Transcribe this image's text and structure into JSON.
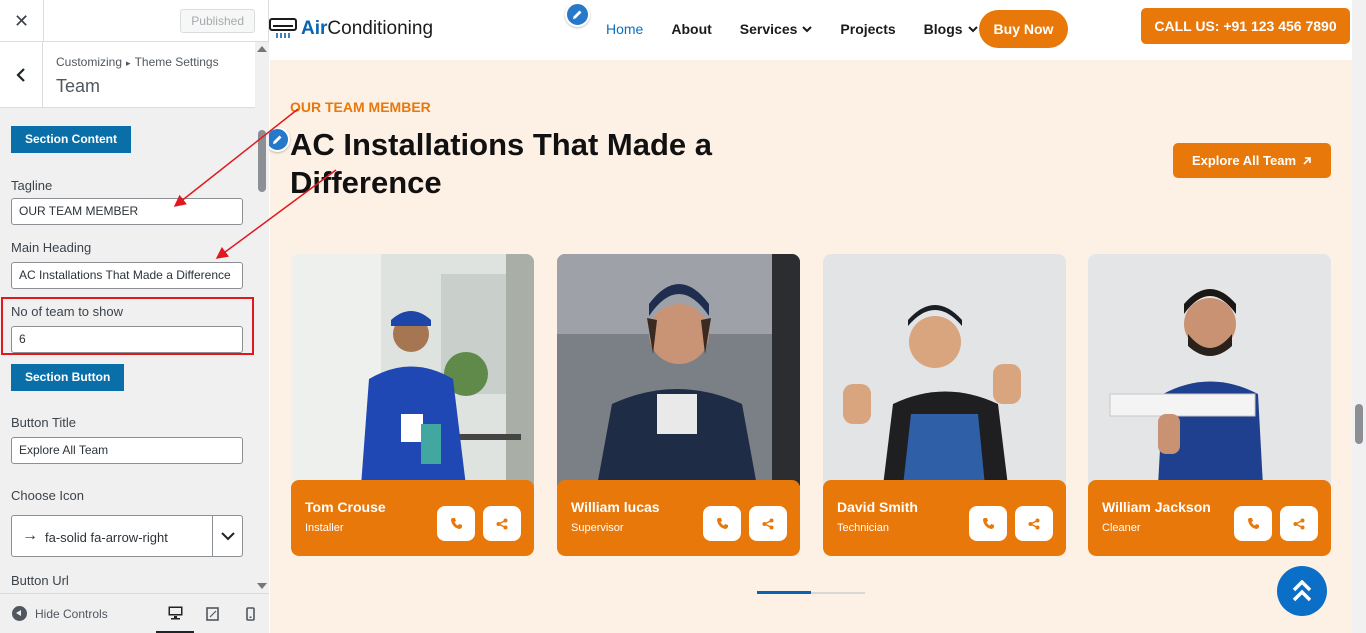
{
  "customizer": {
    "published_label": "Published",
    "breadcrumb": [
      "Customizing",
      "Theme Settings"
    ],
    "panel_title": "Team",
    "section_content_label": "Section Content",
    "tagline_label": "Tagline",
    "tagline_value": "OUR TEAM MEMBER",
    "main_heading_label": "Main Heading",
    "main_heading_value": "AC Installations That Made a Difference",
    "team_count_label": "No of team to show",
    "team_count_value": "6",
    "section_button_label": "Section Button",
    "button_title_label": "Button Title",
    "button_title_value": "Explore All Team",
    "choose_icon_label": "Choose Icon",
    "icon_value": "fa-solid fa-arrow-right",
    "button_url_label": "Button Url",
    "hide_controls_label": "Hide Controls",
    "devices": [
      "desktop",
      "tablet",
      "mobile"
    ],
    "active_device": "desktop"
  },
  "site": {
    "logo": {
      "accent": "Air",
      "rest": "Conditioning"
    },
    "nav": [
      {
        "label": "Home",
        "active": true,
        "dropdown": false
      },
      {
        "label": "About",
        "active": false,
        "dropdown": false
      },
      {
        "label": "Services",
        "active": false,
        "dropdown": true
      },
      {
        "label": "Projects",
        "active": false,
        "dropdown": false
      },
      {
        "label": "Blogs",
        "active": false,
        "dropdown": true
      }
    ],
    "buy_now": "Buy Now",
    "call_us": "CALL US: +91 123 456 7890"
  },
  "team": {
    "tagline": "OUR TEAM MEMBER",
    "heading": "AC Installations That Made a Difference",
    "explore_button": "Explore All Team",
    "members": [
      {
        "name": "Tom Crouse",
        "role": "Installer"
      },
      {
        "name": "William lucas",
        "role": "Supervisor"
      },
      {
        "name": "David Smith",
        "role": "Technician"
      },
      {
        "name": "William Jackson",
        "role": "Cleaner"
      }
    ],
    "carousel_position": 0.5
  },
  "colors": {
    "accent_orange": "#e8780a",
    "brand_blue": "#0b63b4",
    "wp_button_blue": "#0a6fa8",
    "highlight_red": "#e0191e",
    "section_bg": "#fdf1e6"
  }
}
